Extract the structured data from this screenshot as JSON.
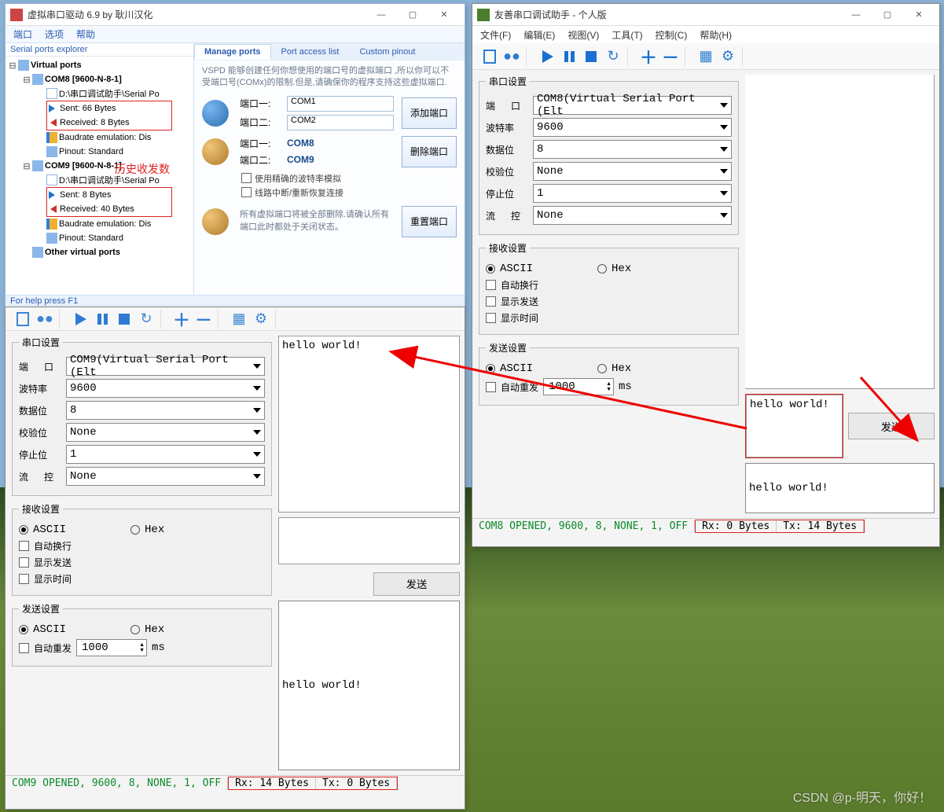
{
  "vspd": {
    "title": "虚拟串口驱动 6.9 by 耿川汉化",
    "menus": [
      "端口",
      "选项",
      "帮助"
    ],
    "tree_header": "Serial ports explorer",
    "tree": {
      "root": "Virtual ports",
      "com8": {
        "label": "COM8 [9600-N-8-1]",
        "app": "D:\\串口调试助手\\Serial Po",
        "sent": "Sent: 66 Bytes",
        "recv": "Received: 8 Bytes",
        "baud": "Baudrate emulation: Dis",
        "pinout": "Pinout: Standard"
      },
      "com9": {
        "label": "COM9 [9600-N-8-1]",
        "app": "D:\\串口调试助手\\Serial Po",
        "sent": "Sent: 8 Bytes",
        "recv": "Received: 40 Bytes",
        "baud": "Baudrate emulation: Dis",
        "pinout": "Pinout: Standard"
      },
      "other": "Other virtual ports"
    },
    "annotation": "历史收发数",
    "tabs": {
      "manage": "Manage ports",
      "access": "Port access list",
      "pinout": "Custom pinout"
    },
    "desc": "VSPD 能够创建任何你想使用的端口号的虚拟端口 ,所以你可以不受端口号(COMx)的限制.但是,请确保你的程序支持这些虚拟端口.",
    "add": {
      "p1label": "端口一:",
      "p2label": "端口二:",
      "p1": "COM1",
      "p2": "COM2",
      "btn": "添加端口"
    },
    "del": {
      "p1label": "端口一:",
      "p2label": "端口二:",
      "p1": "COM8",
      "p2": "COM9",
      "btn": "删除端口",
      "chk1": "使用精确的波特率模拟",
      "chk2": "线路中断/重新恢复连接"
    },
    "reset": {
      "note": "所有虚拟端口将被全部删除.请确认所有端口此时都处于关闭状态。",
      "btn": "重置端口"
    },
    "status": "For help press F1"
  },
  "left": {
    "port_group": "串口设置",
    "port_label": "端　口",
    "port_value": "COM9(Virtual Serial Port (Elt",
    "baud_label": "波特率",
    "baud_value": "9600",
    "data_label": "数据位",
    "data_value": "8",
    "parity_label": "校验位",
    "parity_value": "None",
    "stop_label": "停止位",
    "stop_value": "1",
    "flow_label": "流　控",
    "flow_value": "None",
    "recv_group": "接收设置",
    "ascii": "ASCII",
    "hex": "Hex",
    "autowrap": "自动换行",
    "showsend": "显示发送",
    "showtime": "显示时间",
    "send_group": "发送设置",
    "autorepeat": "自动重发",
    "repeat_ms": "1000",
    "ms": "ms",
    "recv_text": "hello world!",
    "send_btn": "发送",
    "hist": "hello world!",
    "status_open": "COM9 OPENED, 9600, 8, NONE, 1, OFF",
    "rx": "Rx: 14 Bytes",
    "tx": "Tx: 0 Bytes"
  },
  "right": {
    "title": "友善串口调试助手 - 个人版",
    "menus": [
      "文件(F)",
      "编辑(E)",
      "视图(V)",
      "工具(T)",
      "控制(C)",
      "帮助(H)"
    ],
    "port_group": "串口设置",
    "port_label": "端　口",
    "port_value": "COM8(Virtual Serial Port (Elt",
    "baud_label": "波特率",
    "baud_value": "9600",
    "data_label": "数据位",
    "data_value": "8",
    "parity_label": "校验位",
    "parity_value": "None",
    "stop_label": "停止位",
    "stop_value": "1",
    "flow_label": "流　控",
    "flow_value": "None",
    "recv_group": "接收设置",
    "ascii": "ASCII",
    "hex": "Hex",
    "autowrap": "自动换行",
    "showsend": "显示发送",
    "showtime": "显示时间",
    "send_group": "发送设置",
    "autorepeat": "自动重发",
    "repeat_ms": "1000",
    "ms": "ms",
    "send_text": "hello world!",
    "send_btn": "发送",
    "hist": "hello world!",
    "status_open": "COM8 OPENED, 9600, 8, NONE, 1, OFF",
    "rx": "Rx: 0 Bytes",
    "tx": "Tx: 14 Bytes"
  },
  "watermark": "CSDN @p-明天，你好！"
}
